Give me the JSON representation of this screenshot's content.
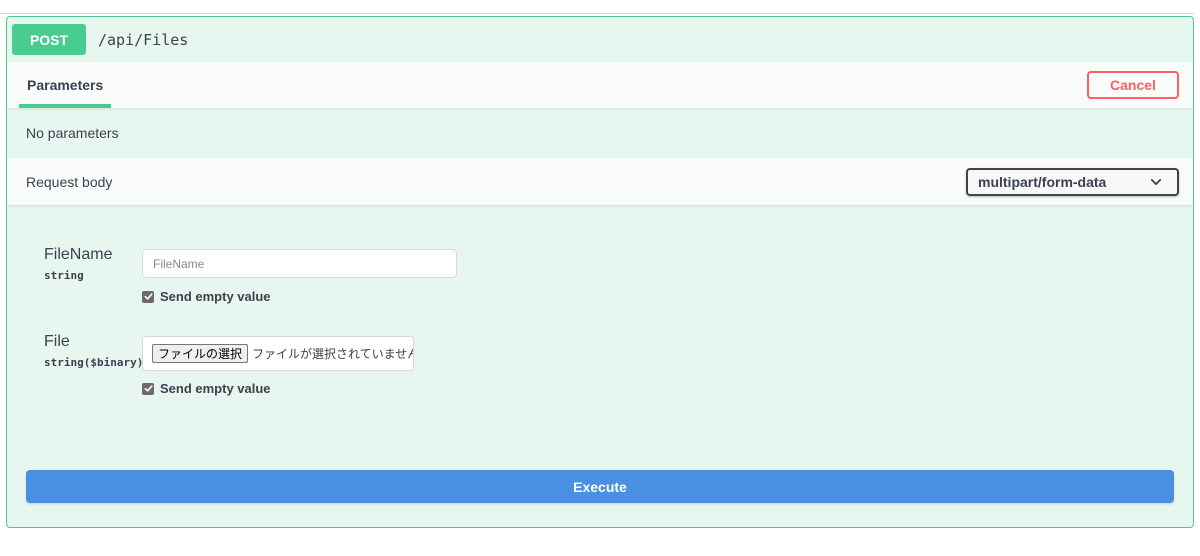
{
  "operation": {
    "method": "POST",
    "path": "/api/Files"
  },
  "parameters": {
    "tab_label": "Parameters",
    "cancel_label": "Cancel",
    "empty_text": "No parameters"
  },
  "request_body": {
    "label": "Request body",
    "content_type": "multipart/form-data",
    "fields": [
      {
        "name": "FileName",
        "type": "string",
        "placeholder": "FileName",
        "send_empty_label": "Send empty value",
        "send_empty_checked": true
      },
      {
        "name": "File",
        "type": "string($binary)",
        "choose_button": "ファイルの選択",
        "no_file_text": "ファイルが選択されていません",
        "send_empty_label": "Send empty value",
        "send_empty_checked": true
      }
    ]
  },
  "execute_label": "Execute",
  "colors": {
    "method_post": "#49cc90",
    "cancel": "#ff6060",
    "execute": "#4990e2",
    "panel_bg": "#e8f6f0"
  },
  "icons": {
    "select_arrow": "chevron-down-icon",
    "checkbox": "checkmark-icon"
  }
}
